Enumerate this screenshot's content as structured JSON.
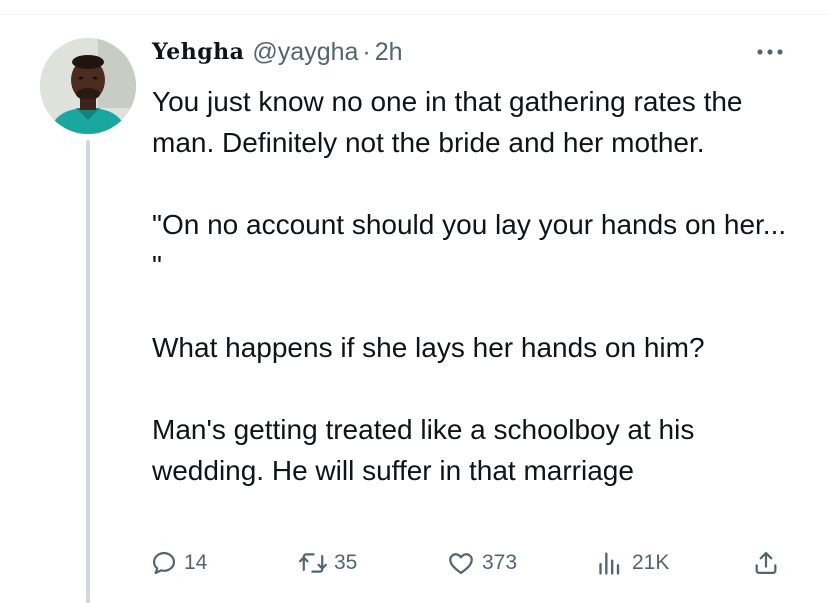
{
  "tweet": {
    "author": {
      "display_name": "Yehgha",
      "handle": "@yaygha",
      "separator": "·",
      "time": "2h",
      "avatar_icon": "profile-photo"
    },
    "paragraphs": [
      "You just know no one in that gathering rates the man. Definitely not the bride and her mother.",
      "\"On no account should you lay your hands on her... \"",
      "What happens if she lays her hands on him?",
      "Man's getting treated like a schoolboy at his wedding. He will suffer in that marriage"
    ],
    "actions": {
      "reply": {
        "icon": "reply-icon",
        "count": "14"
      },
      "retweet": {
        "icon": "retweet-icon",
        "count": "35"
      },
      "like": {
        "icon": "heart-icon",
        "count": "373"
      },
      "views": {
        "icon": "views-icon",
        "count": "21K"
      },
      "share": {
        "icon": "share-icon"
      }
    },
    "more_icon": "more-icon"
  },
  "colors": {
    "text_primary": "#0f1419",
    "text_secondary": "#536471",
    "thread_line": "#cfd9de",
    "divider": "#eff3f4"
  }
}
